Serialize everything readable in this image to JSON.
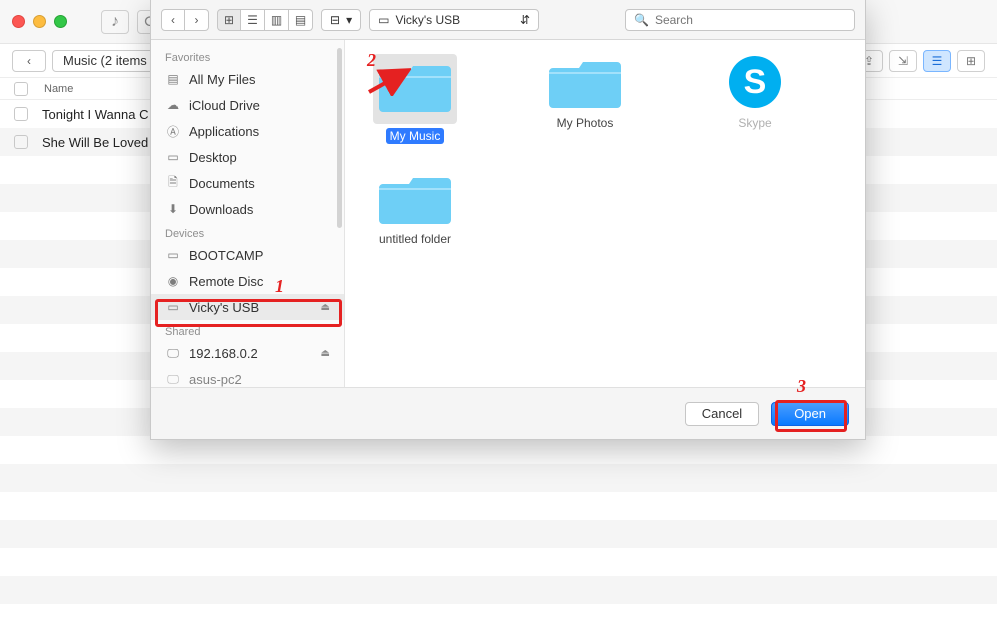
{
  "background": {
    "breadcrumb": "Music (2 items",
    "column_header": "Name",
    "rows": [
      "Tonight I Wanna C",
      "She Will Be Loved"
    ]
  },
  "dialog": {
    "toolbar": {
      "location_label": "Vicky's USB",
      "search_placeholder": "Search"
    },
    "sidebar": {
      "sections": {
        "favorites": {
          "label": "Favorites",
          "items": [
            "All My Files",
            "iCloud Drive",
            "Applications",
            "Desktop",
            "Documents",
            "Downloads"
          ]
        },
        "devices": {
          "label": "Devices",
          "items": [
            "BOOTCAMP",
            "Remote Disc",
            "Vicky's USB"
          ]
        },
        "shared": {
          "label": "Shared",
          "items": [
            "192.168.0.2",
            "asus-pc2"
          ]
        }
      }
    },
    "items": [
      {
        "label": "My Music",
        "selected": true
      },
      {
        "label": "My Photos"
      },
      {
        "label": "Skype",
        "disabled": true,
        "type": "app"
      },
      {
        "label": "untitled folder"
      }
    ],
    "footer": {
      "cancel": "Cancel",
      "open": "Open"
    }
  },
  "annotations": {
    "step1": "1",
    "step2": "2",
    "step3": "3"
  }
}
